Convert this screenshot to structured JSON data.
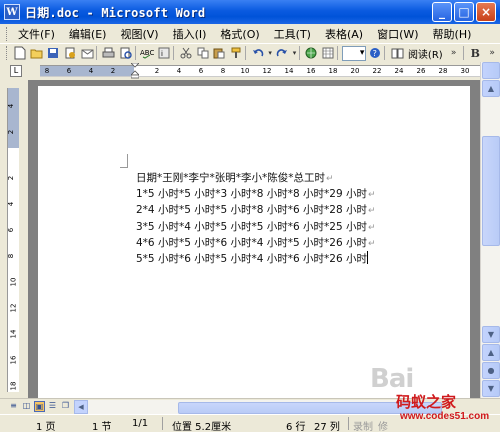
{
  "window": {
    "title": "日期.doc - Microsoft Word",
    "app_icon_letter": "W",
    "minimize": "_",
    "maximize": "□",
    "close": "×"
  },
  "menu": {
    "items": [
      "文件(F)",
      "编辑(E)",
      "视图(V)",
      "插入(I)",
      "格式(O)",
      "工具(T)",
      "表格(A)",
      "窗口(W)",
      "帮助(H)"
    ],
    "overflow_chevron": "»"
  },
  "toolbar": {
    "read_label": "阅读(R)",
    "bold_label": "B",
    "chevron": "»"
  },
  "ruler": {
    "tab_selector": "L",
    "left_numbers": [
      "8",
      "6",
      "4",
      "2"
    ],
    "right_numbers": [
      "2",
      "4",
      "6",
      "8",
      "10",
      "12",
      "14",
      "16",
      "18",
      "20",
      "22",
      "24",
      "26",
      "28",
      "30"
    ],
    "vertical_numbers": [
      "4",
      "2",
      "2",
      "4",
      "6",
      "8",
      "10",
      "12",
      "14",
      "16",
      "18"
    ]
  },
  "document": {
    "lines": [
      "日期*王刚*李宁*张明*李小*陈俊*总工时",
      "1*5 小时*5 小时*3 小时*8 小时*8 小时*29 小时",
      "2*4 小时*5 小时*5 小时*8 小时*6 小时*28 小时",
      "3*5 小时*4 小时*5 小时*5 小时*6 小时*25 小时",
      "4*6 小时*5 小时*6 小时*4 小时*5 小时*26 小时",
      "5*5 小时*6 小时*5 小时*4 小时*6 小时*26 小时"
    ],
    "paragraph_mark": "↵"
  },
  "statusbar": {
    "page": "1 页",
    "section": "1 节",
    "page_of": "1/1",
    "position": "位置 5.2厘米",
    "line": "6 行",
    "column": "27 列",
    "record": "录制",
    "revise": "修"
  },
  "watermark": {
    "bai": "Bai",
    "name": "码蚁之家",
    "url": "www.codes51.com"
  }
}
